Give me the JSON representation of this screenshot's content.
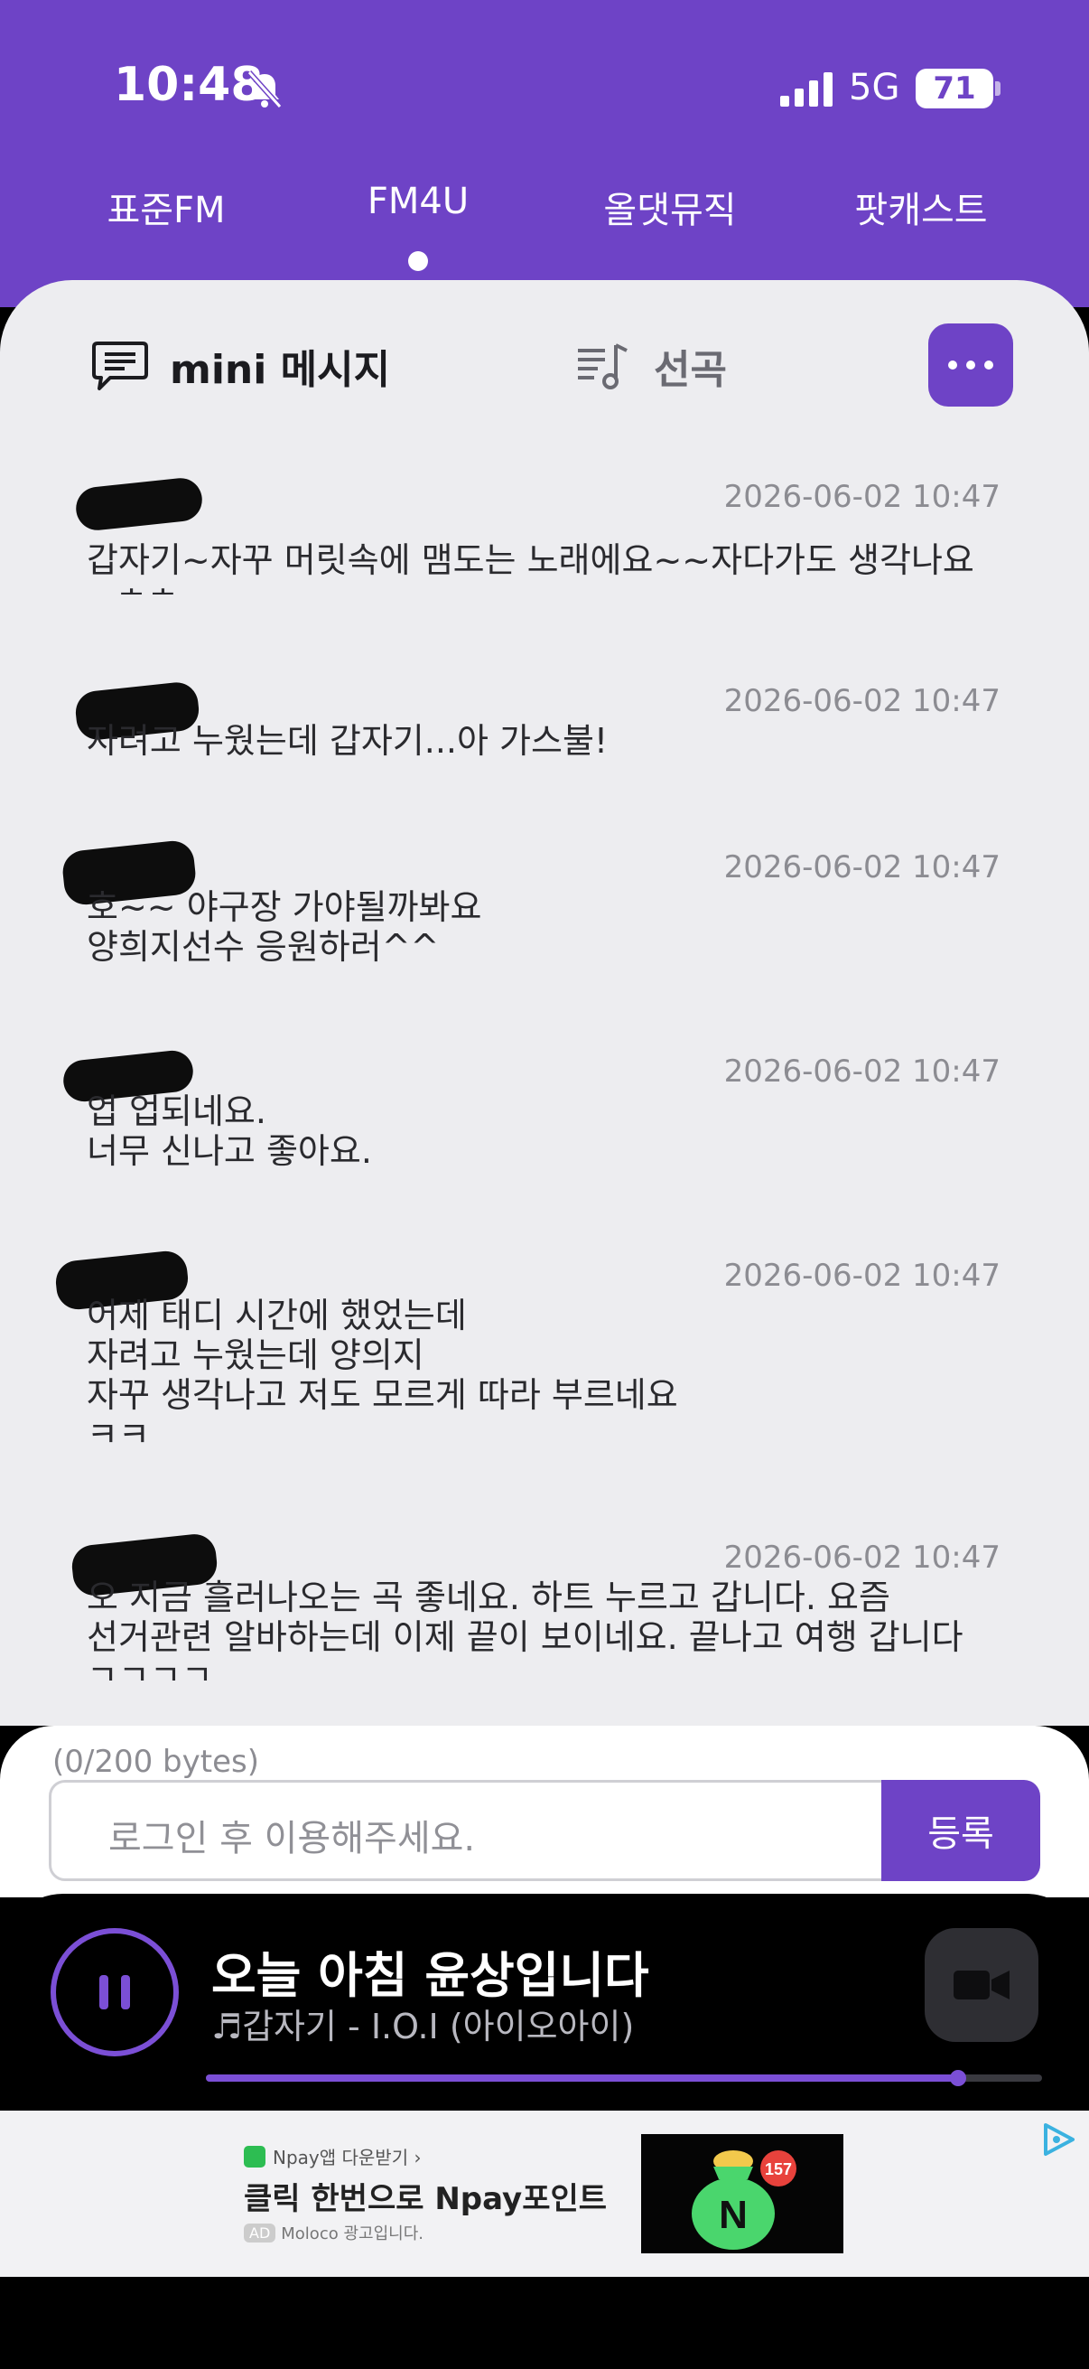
{
  "status_bar": {
    "time": "10:48",
    "network": "5G",
    "battery": "71",
    "icons": [
      "bell-slash-icon",
      "signal-icon",
      "battery-icon"
    ]
  },
  "tabs": {
    "items": [
      {
        "label": "표준FM"
      },
      {
        "label": "FM4U"
      },
      {
        "label": "올댓뮤직"
      },
      {
        "label": "팟캐스트"
      }
    ],
    "active": "FM4U"
  },
  "segments": {
    "mini": "mini 메시지",
    "song": "선곡"
  },
  "messages": [
    {
      "date": "2026-06-02 10:47",
      "text": "갑자기~자꾸 머릿속에 맴도는 노래에요~~자다가도 생각나요\n~ㅎㅎ"
    },
    {
      "date": "2026-06-02 10:47",
      "text": "자려고 누웠는데 갑자기...아 가스불!"
    },
    {
      "date": "2026-06-02 10:47",
      "text": "호~~ 야구장 가야될까봐요\n양희지선수 응원하러^^"
    },
    {
      "date": "2026-06-02 10:47",
      "text": "업 업되네요.\n너무 신나고 좋아요."
    },
    {
      "date": "2026-06-02 10:47",
      "text": "어제 태디 시간에  했었는데\n자려고 누웠는데 양의지\n자꾸 생각나고 저도 모르게 따라 부르네요\nㅋㅋ"
    },
    {
      "date": "2026-06-02 10:47",
      "text": "오 지금 흘러나오는 곡 좋네요. 하트 누르고 갑니다.  요즘\n선거관련 알바하는데 이제 끝이 보이네요. 끝나고 여행 갑니다\nㄱㄱㄱㄱ"
    }
  ],
  "input": {
    "bytes": "(0/200 bytes)",
    "placeholder": "로그인 후 이용해주세요.",
    "submit": "등록"
  },
  "player": {
    "title": "오늘 아침 윤상입니다",
    "song": "♬갑자기 - I.O.I (아이오아이)",
    "progress": 0.9,
    "accent": "#7b4fd6"
  },
  "ad": {
    "top": "Npay앱 다운받기 ›",
    "headline": "클릭 한번으로 Npay포인트",
    "badge": "AD",
    "footer": "Moloco 광고입니다.",
    "count": "157",
    "logo_letter": "N"
  },
  "colors": {
    "brand": "#6e43c6",
    "background": "#ededf0"
  }
}
